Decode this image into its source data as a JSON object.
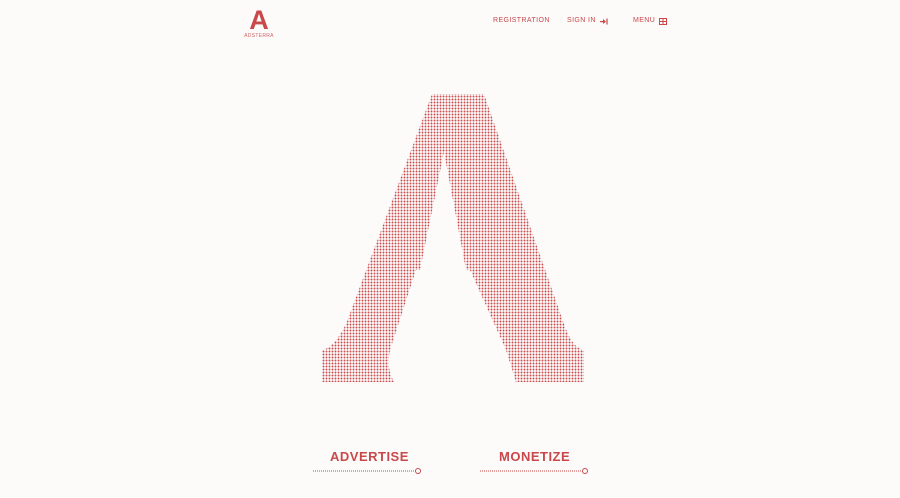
{
  "header": {
    "logo_letter": "A",
    "logo_text": "ADSTERRA"
  },
  "nav": {
    "registration": "REGISTRATION",
    "sign_in": "SIGN IN",
    "menu": "MENU"
  },
  "hero": {
    "letter": "A"
  },
  "cta": {
    "advertise": "ADVERTISE",
    "monetize": "MONETIZE"
  },
  "colors": {
    "accent": "#c9484a",
    "background": "#fcfbfa"
  },
  "icons": {
    "sign_in": "sign-in-icon",
    "menu": "menu-grid-icon"
  }
}
